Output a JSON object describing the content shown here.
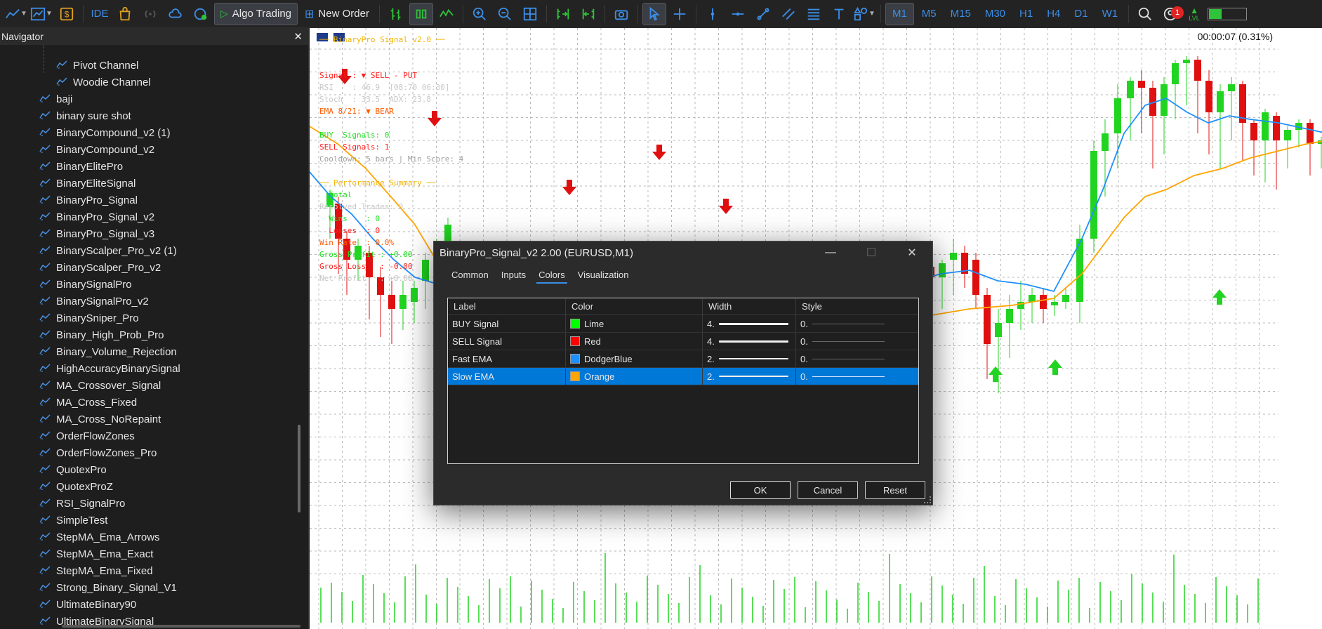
{
  "toolbar": {
    "ide_label": "IDE",
    "algo_label": "Algo Trading",
    "order_label": "New Order",
    "timeframes": [
      "M1",
      "M5",
      "M15",
      "M30",
      "H1",
      "H4",
      "D1",
      "W1"
    ],
    "notif_count": "1",
    "lvl_label": "LVL",
    "colors": {
      "accent": "#3b8ee8",
      "algo_icon": "#2fc23a",
      "dollar": "#e0a020"
    }
  },
  "navigator": {
    "title": "Navigator",
    "close_label": "✕",
    "sub_items": [
      "Pivot Channel",
      "Woodie Channel"
    ],
    "items": [
      "baji",
      "binary sure shot",
      "BinaryCompound_v2 (1)",
      "BinaryCompound_v2",
      "BinaryElitePro",
      "BinaryEliteSignal",
      "BinaryPro_Signal",
      "BinaryPro_Signal_v2",
      "BinaryPro_Signal_v3",
      "BinaryScalper_Pro_v2 (1)",
      "BinaryScalper_Pro_v2",
      "BinarySignalPro",
      "BinarySignalPro_v2",
      "BinarySniper_Pro",
      "Binary_High_Prob_Pro",
      "Binary_Volume_Rejection",
      "HighAccuracyBinarySignal",
      "MA_Crossover_Signal",
      "MA_Cross_Fixed",
      "MA_Cross_NoRepaint",
      "OrderFlowZones",
      "OrderFlowZones_Pro",
      "QuotexPro",
      "QuotexProZ",
      "RSI_SignalPro",
      "SimpleTest",
      "StepMA_Ema_Arrows",
      "StepMA_Ema_Exact",
      "StepMA_Ema_Fixed",
      "Strong_Binary_Signal_V1",
      "UltimateBinary90",
      "UltimateBinarySignal"
    ]
  },
  "chart": {
    "timer": "00:00:07 (0.31%)",
    "info_lines": [
      {
        "text": "── BinaryPro Signal v2.0 ──",
        "color": "#f0b400"
      },
      {
        "text": "",
        "color": "#000"
      },
      {
        "text": "",
        "color": "#000"
      },
      {
        "text": "Signal : ▼ SELL - PUT",
        "color": "#ff2020"
      },
      {
        "text": "RSI    : 46.9  [08:70 06:30]",
        "color": "#c8c8c8"
      },
      {
        "text": "Stoch  : 33.5  ADX: 23.8",
        "color": "#c8c8c8"
      },
      {
        "text": "EMA 8/21: ▼ BEAR",
        "color": "#ff5a00"
      },
      {
        "text": "",
        "color": "#000"
      },
      {
        "text": "BUY  Signals: 0",
        "color": "#20e020"
      },
      {
        "text": "SELL Signals: 1",
        "color": "#ff2020"
      },
      {
        "text": "Cooldown: 5 bars | Min Score: 4",
        "color": "#a0a0a0"
      },
      {
        "text": "",
        "color": "#000"
      },
      {
        "text": "── Performance Summary ──",
        "color": "#f0b400"
      },
      {
        "text": "  Total",
        "color": "#20e020"
      },
      {
        "text": "Resolved Trades: 0",
        "color": "#c8c8c8"
      },
      {
        "text": "  Wins    : 0",
        "color": "#20e020"
      },
      {
        "text": "  Losses  : 0",
        "color": "#ff2020"
      },
      {
        "text": "Win Rate  : 0.0%",
        "color": "#ff5a00"
      },
      {
        "text": "Gross Profit : +0.00",
        "color": "#20e020"
      },
      {
        "text": "Gross Loss   : -0.00",
        "color": "#ff2020"
      },
      {
        "text": "Net Profit   : +0.00",
        "color": "#c8c8c8"
      }
    ],
    "colors": {
      "up": "#21d421",
      "down": "#e01010",
      "fast_ema": "#1e90ff",
      "slow_ema": "#ffa500",
      "grid": "#b8b8b8"
    }
  },
  "dialog": {
    "title": "BinaryPro_Signal_v2 2.00 (EURUSD,M1)",
    "tabs": [
      "Common",
      "Inputs",
      "Colors",
      "Visualization"
    ],
    "active_tab": "Colors",
    "columns": [
      "Label",
      "Color",
      "Width",
      "Style"
    ],
    "rows": [
      {
        "label": "BUY Signal",
        "color_name": "Lime",
        "color_hex": "#00ff00",
        "width": "4.",
        "style": "0."
      },
      {
        "label": "SELL Signal",
        "color_name": "Red",
        "color_hex": "#ff0000",
        "width": "4.",
        "style": "0."
      },
      {
        "label": "Fast EMA",
        "color_name": "DodgerBlue",
        "color_hex": "#1e90ff",
        "width": "2.",
        "style": "0."
      },
      {
        "label": "Slow EMA",
        "color_name": "Orange",
        "color_hex": "#ffa500",
        "width": "2.",
        "style": "0."
      }
    ],
    "buttons": {
      "ok": "OK",
      "cancel": "Cancel",
      "reset": "Reset"
    }
  }
}
